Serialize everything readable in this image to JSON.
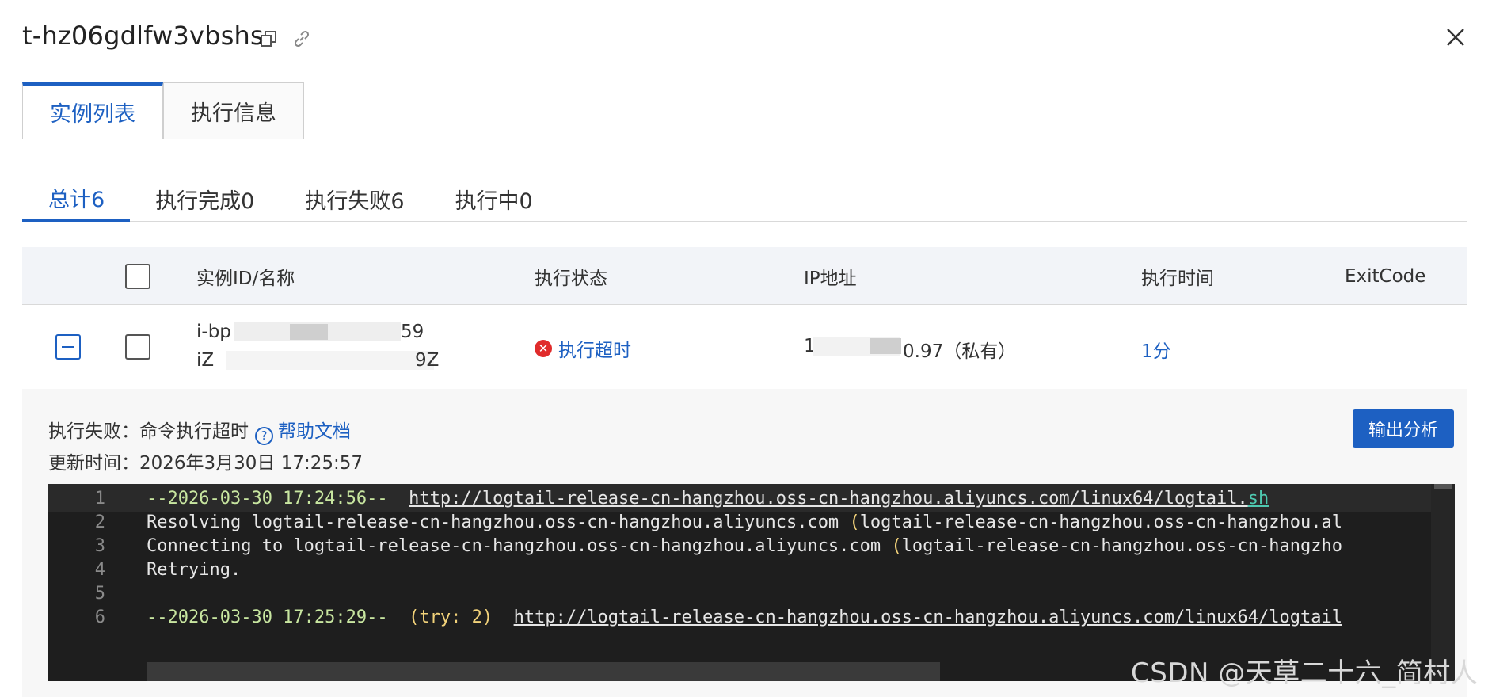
{
  "header": {
    "title": "t-hz06gdlfw3vbshs",
    "copy_icon": "copy-icon",
    "link_icon": "link-icon",
    "close_icon": "close-icon"
  },
  "tabs": [
    {
      "label": "实例列表",
      "active": true
    },
    {
      "label": "执行信息",
      "active": false
    }
  ],
  "filters": [
    {
      "label": "总计6",
      "active": true
    },
    {
      "label": "执行完成0",
      "active": false
    },
    {
      "label": "执行失败6",
      "active": false
    },
    {
      "label": "执行中0",
      "active": false
    }
  ],
  "table": {
    "columns": [
      "实例ID/名称",
      "执行状态",
      "IP地址",
      "执行时间",
      "ExitCode"
    ],
    "rows": [
      {
        "id_prefix": "i-bp",
        "id_suffix": "59",
        "name_prefix": "iZ",
        "name_suffix": "9Z",
        "status": "执行超时",
        "status_color": "#e02b2b",
        "ip_prefix": "1",
        "ip_suffix": "0.97（私有）",
        "time": "1分",
        "exit_code": ""
      }
    ]
  },
  "detail": {
    "fail_label": "执行失败：",
    "fail_reason": "命令执行超时",
    "help_link": "帮助文档",
    "update_label": "更新时间：",
    "update_time": "2026年3月30日 17:25:57",
    "output_button": "输出分析"
  },
  "code": {
    "lines": [
      {
        "n": "1",
        "parts": [
          {
            "c": "g",
            "t": "--2026-03-30 17:24:56--  "
          },
          {
            "c": "u",
            "t": "http://logtail-release-cn-hangzhou.oss-cn-hangzhou.aliyuncs.com/linux64/logtail."
          },
          {
            "c": "t",
            "t": "sh"
          }
        ]
      },
      {
        "n": "2",
        "parts": [
          {
            "c": "w",
            "t": "Resolving logtail-release-cn-hangzhou.oss-cn-hangzhou.aliyuncs.com "
          },
          {
            "c": "y",
            "t": "("
          },
          {
            "c": "w",
            "t": "logtail-release-cn-hangzhou.oss-cn-hangzhou.al"
          }
        ]
      },
      {
        "n": "3",
        "parts": [
          {
            "c": "w",
            "t": "Connecting to logtail-release-cn-hangzhou.oss-cn-hangzhou.aliyuncs.com "
          },
          {
            "c": "y",
            "t": "("
          },
          {
            "c": "w",
            "t": "logtail-release-cn-hangzhou.oss-cn-hangzho"
          }
        ]
      },
      {
        "n": "4",
        "parts": [
          {
            "c": "w",
            "t": "Retrying."
          }
        ]
      },
      {
        "n": "5",
        "parts": []
      },
      {
        "n": "6",
        "parts": [
          {
            "c": "g",
            "t": "--2026-03-30 17:25:29--  "
          },
          {
            "c": "y",
            "t": "(try: 2)  "
          },
          {
            "c": "u",
            "t": "http://logtail-release-cn-hangzhou.oss-cn-hangzhou.aliyuncs.com/linux64/logtail"
          }
        ]
      }
    ]
  },
  "watermark": "CSDN @天草二十六_简村人"
}
